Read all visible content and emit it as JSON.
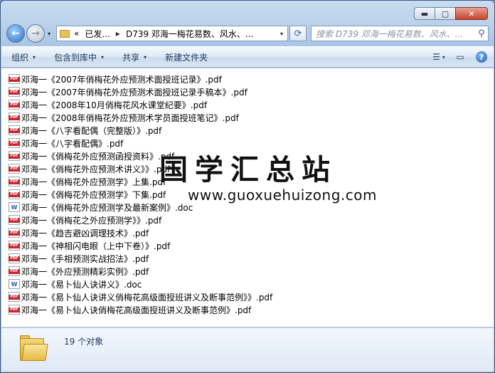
{
  "window": {
    "minimize_glyph": "▬",
    "maximize_glyph": "▢",
    "close_glyph": "✕"
  },
  "nav": {
    "back_glyph": "←",
    "forward_glyph": "→",
    "history_glyph": "▾",
    "address": {
      "prefix": "«",
      "segments": [
        "已发...",
        "D739 邓海一梅花易数、风水、..."
      ],
      "separator": "▶",
      "dropdown_glyph": "▾"
    },
    "refresh_glyph": "⟳",
    "search": {
      "placeholder": "搜索 D739 邓海一梅花易数、风水、...",
      "icon_glyph": "⚲"
    }
  },
  "commands": {
    "organize": "组织",
    "include_in_library": "包含到库中",
    "share": "共享",
    "new_folder": "新建文件夹",
    "dropdown_glyph": "▾",
    "view_glyph": "☰",
    "preview_glyph": "▭",
    "help_glyph": "?"
  },
  "files": [
    {
      "name": "邓海一《2007年俏梅花外应预测术面授班记录》.pdf",
      "type": "pdf"
    },
    {
      "name": "邓海一《2007年俏梅花外应预测术面授班记录手稿本》.pdf",
      "type": "pdf"
    },
    {
      "name": "邓海一《2008年10月俏梅花风水课堂纪要》.pdf",
      "type": "pdf"
    },
    {
      "name": "邓海一《2008年俏梅花外应预测术学员面授班笔记》.pdf",
      "type": "pdf"
    },
    {
      "name": "邓海一《八字看配偶（完整版）》.pdf",
      "type": "pdf"
    },
    {
      "name": "邓海一《八字看配偶》.pdf",
      "type": "pdf"
    },
    {
      "name": "邓海一《俏梅花外应预测函授资料》.pdf",
      "type": "pdf"
    },
    {
      "name": "邓海一《俏梅花外应预测术讲义》》.pdf",
      "type": "pdf"
    },
    {
      "name": "邓海一《俏梅花外应预测学》上集.pdf",
      "type": "pdf"
    },
    {
      "name": "邓海一《俏梅花外应预测学》下集.pdf",
      "type": "pdf"
    },
    {
      "name": "邓海一《俏梅花外应预测学及最新案例》.doc",
      "type": "doc"
    },
    {
      "name": "邓海一《俏梅花之外应预测学》》.pdf",
      "type": "pdf"
    },
    {
      "name": "邓海一《趋吉避凶调理技术》.pdf",
      "type": "pdf"
    },
    {
      "name": "邓海一《神相闪电眼（上中下卷）》.pdf",
      "type": "pdf"
    },
    {
      "name": "邓海一《手相预测实战招法》.pdf",
      "type": "pdf"
    },
    {
      "name": "邓海一《外应预测精彩实例》.pdf",
      "type": "pdf"
    },
    {
      "name": "邓海一《易卜仙人诀讲义》.doc",
      "type": "doc"
    },
    {
      "name": "邓海一《易卜仙人诀讲义俏梅花高级面授班讲义及断事范例》》.pdf",
      "type": "pdf"
    },
    {
      "name": "邓海一《易卜仙人诀俏梅花高级面授班讲义及断事范例》.pdf",
      "type": "pdf"
    }
  ],
  "watermark": {
    "title": "国学汇总站",
    "url": "www.guoxuehuizong.com"
  },
  "details": {
    "item_count": "19 个对象"
  }
}
